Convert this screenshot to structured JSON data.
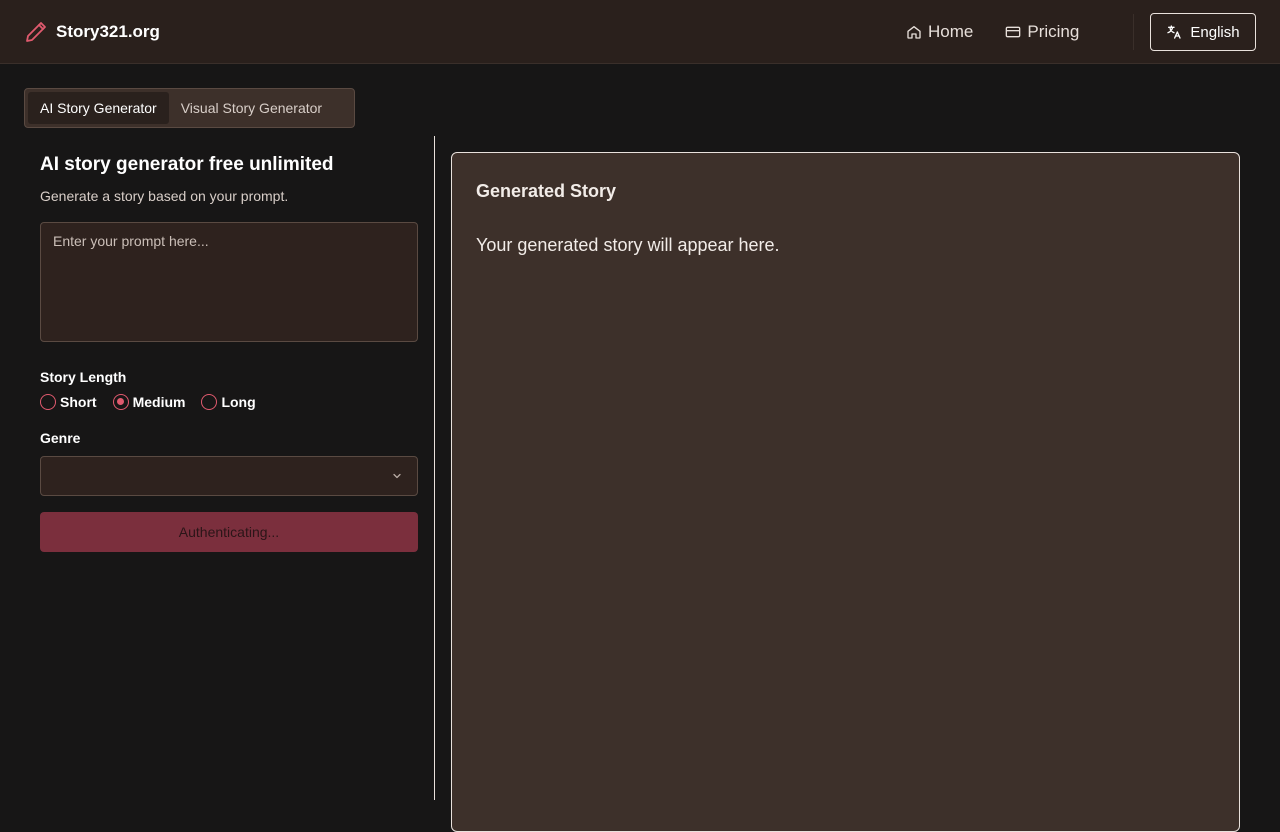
{
  "header": {
    "brand": "Story321.org",
    "nav": [
      {
        "label": "Home",
        "icon": "home-icon"
      },
      {
        "label": "Pricing",
        "icon": "credit-card-icon"
      }
    ],
    "language": {
      "label": "English",
      "icon": "translate-icon"
    }
  },
  "tabs": [
    {
      "label": "AI Story Generator",
      "active": true
    },
    {
      "label": "Visual Story Generator",
      "active": false
    }
  ],
  "form": {
    "title": "AI story generator free unlimited",
    "subtitle": "Generate a story based on your prompt.",
    "prompt_placeholder": "Enter your prompt here...",
    "prompt_value": "",
    "length_label": "Story Length",
    "length_options": [
      "Short",
      "Medium",
      "Long"
    ],
    "length_selected": "Medium",
    "genre_label": "Genre",
    "genre_value": "",
    "submit_label": "Authenticating..."
  },
  "output": {
    "title": "Generated Story",
    "placeholder": "Your generated story will appear here."
  },
  "colors": {
    "accent": "#e05a6e",
    "button_bg": "#7b2f3d",
    "card_bg": "#3d302a",
    "page_bg": "#171616"
  }
}
